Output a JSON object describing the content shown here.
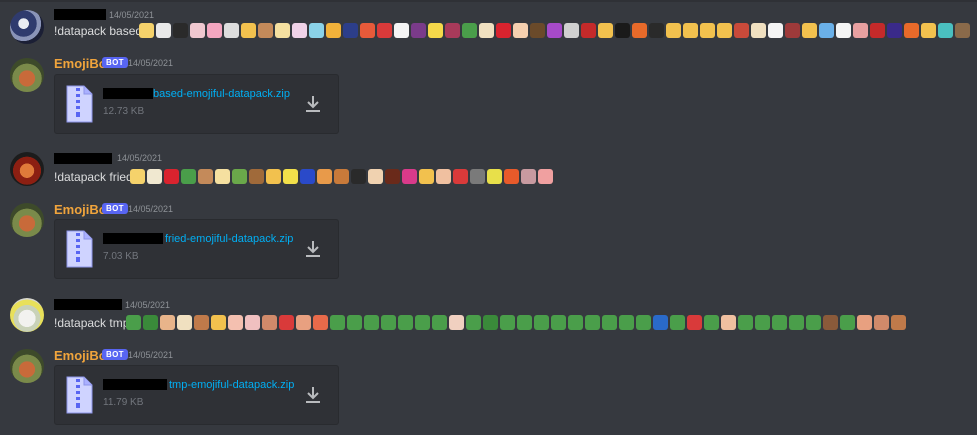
{
  "messages": [
    {
      "username": "",
      "timestamp": "14/05/2021",
      "text": "!datapack based"
    },
    {
      "username": "EmojiBot",
      "bot_tag": "BOT",
      "timestamp": "14/05/2021",
      "attachment": {
        "filename": "based-emojiful-datapack.zip",
        "size": "12.73 KB"
      }
    },
    {
      "username": "",
      "timestamp": "14/05/2021",
      "text": "!datapack fried"
    },
    {
      "username": "EmojiBot",
      "bot_tag": "BOT",
      "timestamp": "14/05/2021",
      "attachment": {
        "filename": "fried-emojiful-datapack.zip",
        "size": "7.03 KB"
      }
    },
    {
      "username": "",
      "timestamp": "14/05/2021",
      "text": "!datapack tmp"
    },
    {
      "username": "EmojiBot",
      "bot_tag": "BOT",
      "timestamp": "14/05/2021",
      "attachment": {
        "filename": "tmp-emojiful-datapack.zip",
        "size": "11.79 KB"
      }
    }
  ],
  "emoji_palettes": {
    "based": [
      "#f5d26b",
      "#e9e9e9",
      "#2a2a2a",
      "#f0c8d0",
      "#f4a6c0",
      "#dddddd",
      "#f2c14e",
      "#c48a5a",
      "#f5e0a0",
      "#f0d2e8",
      "#8ad2e8",
      "#f2b23a",
      "#2c3e8a",
      "#e85a3a",
      "#d93a3a",
      "#f4f4f4",
      "#7a3b8a",
      "#f5d84a",
      "#a83a5a",
      "#4a9e4a",
      "#f0e0c0",
      "#d9232e",
      "#f5d0b0",
      "#6a4a2a",
      "#a64ac9",
      "#d0d0d0",
      "#c42a2a",
      "#f2c14e",
      "#1a1a1a",
      "#e86a2a",
      "#2a2a2a",
      "#f2c14e",
      "#f2c14e",
      "#f2c14e",
      "#f2c14e",
      "#c94a3a",
      "#f0e0c0",
      "#f4f4f4",
      "#9e3a3a",
      "#f2c14e",
      "#6ab0e8",
      "#f4f4f4",
      "#e8a0a0",
      "#c42a2a",
      "#3a2a8a",
      "#e86a2a",
      "#f2c14e",
      "#4ac0c0",
      "#8a6a4a"
    ],
    "fried": [
      "#f5d26b",
      "#f0e8d0",
      "#d9232e",
      "#4a9e4a",
      "#c48a5a",
      "#f5e0a0",
      "#6aa84a",
      "#a06a3a",
      "#f2c14e",
      "#f2e04a",
      "#2a4ac9",
      "#e89a4a",
      "#c87a3a",
      "#2a2a2a",
      "#f0d2b0",
      "#6a2a1a",
      "#d93a8a",
      "#f2c14e",
      "#f0c0a0",
      "#d93a3a",
      "#7a7a7a",
      "#e8e04a",
      "#e85a2a",
      "#c89aa0",
      "#f0a0a0"
    ],
    "tmp": [
      "#4a9e4a",
      "#3a8a3a",
      "#e8b48a",
      "#f0e0c0",
      "#c07a4a",
      "#f2c14e",
      "#f4c0b0",
      "#f0c0c0",
      "#d08a6a",
      "#d93a3a",
      "#e8a080",
      "#e86a4a",
      "#4a9e4a",
      "#4a9e4a",
      "#4a9e4a",
      "#4a9e4a",
      "#4a9e4a",
      "#4a9e4a",
      "#4a9e4a",
      "#f0d0c0",
      "#4a9e4a",
      "#3a8a3a",
      "#4a9e4a",
      "#4a9e4a",
      "#4a9e4a",
      "#4a9e4a",
      "#4a9e4a",
      "#4a9e4a",
      "#4a9e4a",
      "#4a9e4a",
      "#4a9e4a",
      "#2a6ac9",
      "#4a9e4a",
      "#d93a3a",
      "#4a9e4a",
      "#f0c0a0",
      "#4a9e4a",
      "#4a9e4a",
      "#4a9e4a",
      "#4a9e4a",
      "#4a9e4a",
      "#8a5a3a",
      "#4a9e4a",
      "#e8a080",
      "#d08a6a",
      "#c07a4a"
    ]
  }
}
